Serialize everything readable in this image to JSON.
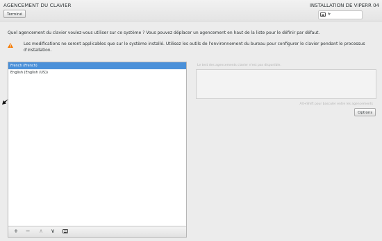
{
  "header": {
    "title": "AGENCEMENT DU CLAVIER",
    "done_label": "Terminé",
    "install_title": "INSTALLATION DE VIPERR 04",
    "keyboard_indicator": "fr"
  },
  "instructions": {
    "question": "Quel agencement du clavier voulez-vous utiliser sur ce système ? Vous pouvez déplacer un agencement en haut de la liste pour le définir par défaut.",
    "warning_line1": "Les modifications ne seront applicables que sur le système installé. Utilisez les outils de l'environnement du bureau pour configurer le clavier pendant le processus",
    "warning_line2": "d'installation."
  },
  "layouts": {
    "items": [
      {
        "label": "French (French)",
        "selected": true
      },
      {
        "label": "English (English (US))",
        "selected": false
      }
    ]
  },
  "toolbar": {
    "add": "+",
    "remove": "−",
    "move_up": "∧",
    "move_down": "∨",
    "preview_icon": "keyboard-icon"
  },
  "test": {
    "label": "Le test des agencements clavier n'est pas disponible.",
    "switch_hint": "Alt+Shift pour basculer entre les agencements",
    "options_label": "Options"
  },
  "colors": {
    "selection": "#4a90d9",
    "warning": "#f57900"
  }
}
